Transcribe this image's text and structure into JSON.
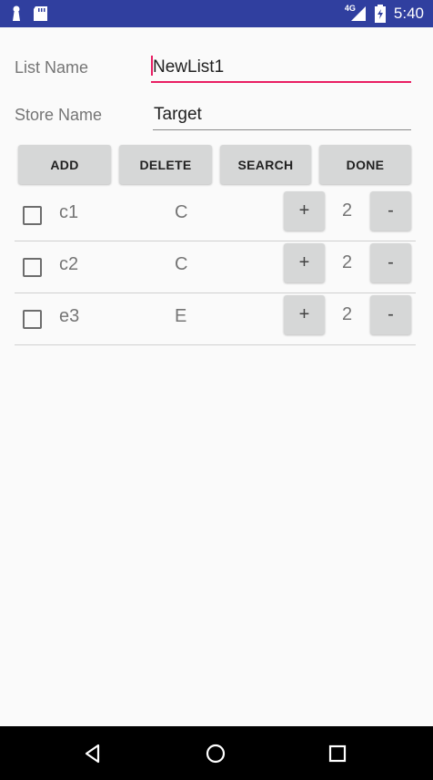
{
  "status_bar": {
    "time": "5:40",
    "network_label": "4G",
    "icons": [
      "notification-icon",
      "sd-card-icon",
      "signal-icon",
      "battery-icon"
    ]
  },
  "form": {
    "list_name_label": "List Name",
    "list_name_value": "NewList1",
    "store_name_label": "Store Name",
    "store_name_value": "Target"
  },
  "actions": {
    "add": "ADD",
    "delete": "DELETE",
    "search": "SEARCH",
    "done": "DONE"
  },
  "items": [
    {
      "checked": false,
      "name": "c1",
      "category": "C",
      "plus": "+",
      "quantity": "2",
      "minus": "-"
    },
    {
      "checked": false,
      "name": "c2",
      "category": "C",
      "plus": "+",
      "quantity": "2",
      "minus": "-"
    },
    {
      "checked": false,
      "name": "e3",
      "category": "E",
      "plus": "+",
      "quantity": "2",
      "minus": "-"
    }
  ],
  "nav_bar": {
    "icons": [
      "back-icon",
      "home-icon",
      "recents-icon"
    ]
  },
  "colors": {
    "status_bar": "#303f9f",
    "accent": "#e91e63",
    "button": "#d6d7d7",
    "background": "#fafafa"
  }
}
